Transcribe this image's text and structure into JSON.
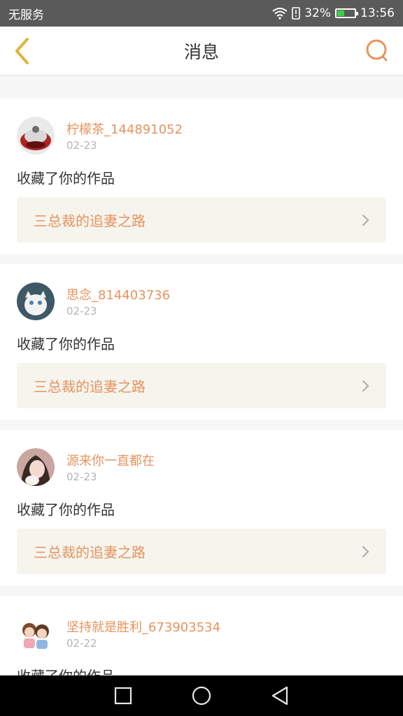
{
  "status_bar": {
    "carrier": "无服务",
    "battery_pct": "32%",
    "time": "13:56"
  },
  "nav": {
    "title": "消息",
    "back_icon": "chevron-left-icon",
    "search_icon": "search-icon"
  },
  "messages": [
    {
      "username": "柠檬茶_144891052",
      "date": "02-23",
      "action": "收藏了你的作品",
      "work_title": "三总裁的追妻之路"
    },
    {
      "username": "思念_814403736",
      "date": "02-23",
      "action": "收藏了你的作品",
      "work_title": "三总裁的追妻之路"
    },
    {
      "username": "源来你一直都在",
      "date": "02-23",
      "action": "收藏了你的作品",
      "work_title": "三总裁的追妻之路"
    },
    {
      "username": "坚持就是胜利_673903534",
      "date": "02-22",
      "action": "收藏了你的作品",
      "work_title": ""
    }
  ],
  "colors": {
    "accent": "#e6935d",
    "back_icon": "#e0b43a",
    "work_bg": "#f5f5ee"
  }
}
